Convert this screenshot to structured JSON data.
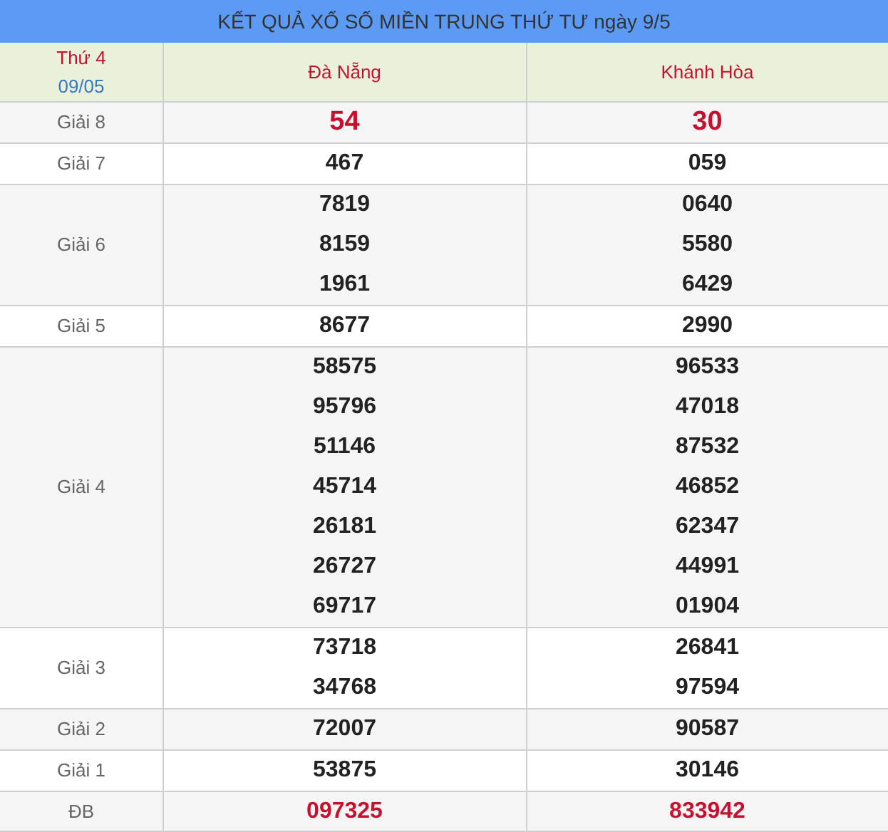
{
  "title": "KẾT QUẢ XỔ SỐ MIỀN TRUNG THỨ TƯ ngày 9/5",
  "header": {
    "weekday": "Thứ 4",
    "date": "09/05",
    "provinces": [
      "Đà Nẵng",
      "Khánh Hòa"
    ]
  },
  "rows": [
    {
      "label": "Giải 8",
      "highlight": true,
      "large": true,
      "results": [
        [
          "54"
        ],
        [
          "30"
        ]
      ]
    },
    {
      "label": "Giải 7",
      "highlight": false,
      "large": false,
      "results": [
        [
          "467"
        ],
        [
          "059"
        ]
      ]
    },
    {
      "label": "Giải 6",
      "highlight": false,
      "large": false,
      "results": [
        [
          "7819",
          "8159",
          "1961"
        ],
        [
          "0640",
          "5580",
          "6429"
        ]
      ]
    },
    {
      "label": "Giải 5",
      "highlight": false,
      "large": false,
      "results": [
        [
          "8677"
        ],
        [
          "2990"
        ]
      ]
    },
    {
      "label": "Giải 4",
      "highlight": false,
      "large": false,
      "results": [
        [
          "58575",
          "95796",
          "51146",
          "45714",
          "26181",
          "26727",
          "69717"
        ],
        [
          "96533",
          "47018",
          "87532",
          "46852",
          "62347",
          "44991",
          "01904"
        ]
      ]
    },
    {
      "label": "Giải 3",
      "highlight": false,
      "large": false,
      "results": [
        [
          "73718",
          "34768"
        ],
        [
          "26841",
          "97594"
        ]
      ]
    },
    {
      "label": "Giải 2",
      "highlight": false,
      "large": false,
      "results": [
        [
          "72007"
        ],
        [
          "90587"
        ]
      ]
    },
    {
      "label": "Giải 1",
      "highlight": false,
      "large": false,
      "results": [
        [
          "53875"
        ],
        [
          "30146"
        ]
      ]
    },
    {
      "label": "ĐB",
      "highlight": true,
      "large": false,
      "results": [
        [
          "097325"
        ],
        [
          "833942"
        ]
      ]
    }
  ]
}
